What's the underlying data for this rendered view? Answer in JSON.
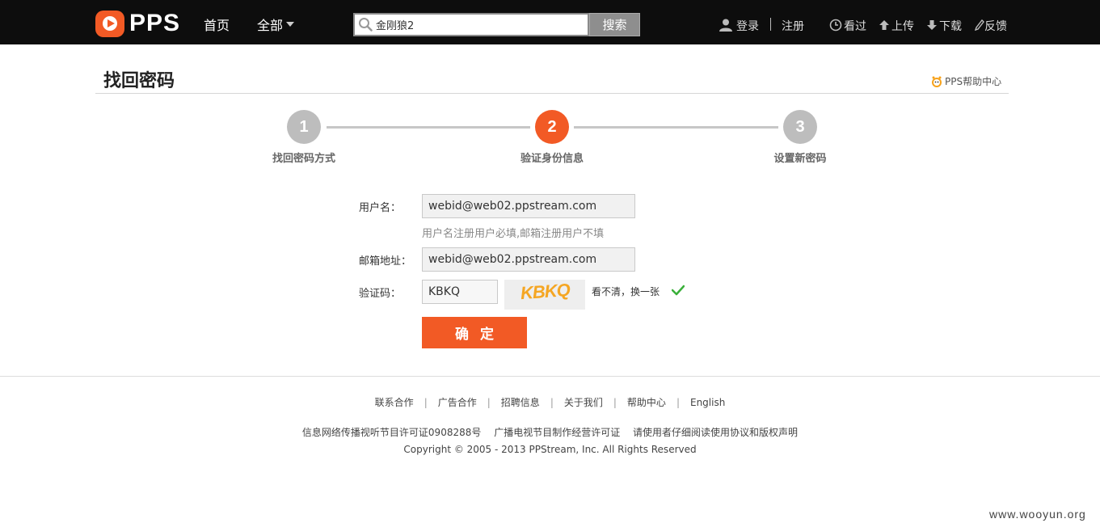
{
  "header": {
    "logo_text": "PPS",
    "nav": {
      "home": "首页",
      "all": "全部"
    },
    "search": {
      "value": "金刚狼2",
      "button": "搜索"
    },
    "user": {
      "login": "登录",
      "register": "注册"
    },
    "tools": {
      "history": "看过",
      "upload": "上传",
      "download": "下载",
      "feedback": "反馈"
    }
  },
  "page": {
    "title": "找回密码",
    "help_center": "PPS帮助中心"
  },
  "steps": [
    {
      "number": "1",
      "label": "找回密码方式",
      "active": false
    },
    {
      "number": "2",
      "label": "验证身份信息",
      "active": true
    },
    {
      "number": "3",
      "label": "设置新密码",
      "active": false
    }
  ],
  "form": {
    "username_label": "用户名：",
    "username_value": "webid@web02.ppstream.com",
    "username_hint": "用户名注册用户必填,邮箱注册用户不填",
    "email_label": "邮箱地址：",
    "email_value": "webid@web02.ppstream.com",
    "captcha_label": "验证码：",
    "captcha_value": "KBKQ",
    "captcha_image_text": "KBKQ",
    "refresh_link": "看不清，换一张",
    "submit": "确定"
  },
  "footer": {
    "links": [
      "联系合作",
      "广告合作",
      "招聘信息",
      "关于我们",
      "帮助中心",
      "English"
    ],
    "licenses": [
      "信息网络传播视听节目许可证0908288号",
      "广播电视节目制作经营许可证",
      "请使用者仔细阅读使用协议和版权声明"
    ],
    "copyright": "Copyright © 2005 - 2013 PPStream, Inc. All Rights Reserved"
  },
  "watermark": "www.wooyun.org",
  "colors": {
    "accent": "#f25a25",
    "header_bg": "#0d0d0d",
    "step_inactive": "#bdbdbd",
    "check": "#3ab03a"
  }
}
